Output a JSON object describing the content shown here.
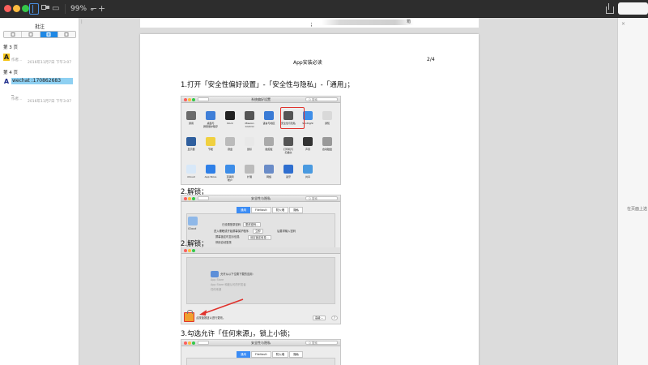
{
  "toolbar": {
    "zoom": "99% ⌄",
    "minus": "−",
    "plus": "+"
  },
  "sidebar": {
    "title": "批注",
    "sections": [
      {
        "page": "第 3 页",
        "author": "作者…",
        "date": "2016年11月7日 下午3:07"
      },
      {
        "page": "第 4 页",
        "highlight": "wechat :170862683",
        "dash": "_",
        "author": "作者…",
        "date": "2016年11月7日 下午3:07"
      }
    ]
  },
  "document": {
    "prev_page_semicolon": "；",
    "prev_page_blur_suffix": "箱",
    "page_title": "App安装必读",
    "page_number": "2/4",
    "steps": [
      "1.打开「安全性偏好设置」-「安全性与隐私」-「通用」；",
      "2.解锁；",
      "2.解锁；",
      "3.勾选允许「任何来源」，锁上小锁；"
    ],
    "shot1": {
      "title": "系统偏好设置",
      "search": "Q 搜索",
      "row1": [
        "通用",
        "桌面与\n屏幕保护程序",
        "Dock",
        "Mission\nControl",
        "语言与地区",
        "安全性与隐私",
        "Spotlight",
        "通知"
      ],
      "row2": [
        "显示器",
        "节能",
        "键盘",
        "鼠标",
        "触控板",
        "打印机与\n扫描仪",
        "声音",
        "启动磁盘"
      ],
      "row3": [
        "iCloud",
        "App Store",
        "互联网\n帐户",
        "扩展",
        "网络",
        "蓝牙",
        "共享"
      ]
    },
    "shot2": {
      "title": "安全性与隐私",
      "search": "Q 搜索",
      "tabs": [
        "通用",
        "FileVault",
        "防火墙",
        "隐私"
      ],
      "icloud_label": "iCloud",
      "login_pw": "已设置登录密码",
      "change_pw": "更改密码…",
      "require_pw": "进入睡眠或开始屏幕保护程序",
      "require_value": "立即",
      "require_suffix": "后要求输入密码",
      "show_msg": "屏幕锁定时显示信息",
      "set_msg": "设定锁定信息…",
      "auto_login": "停用自动登录"
    },
    "shot2b": {
      "allow_from": "允许从以下位置下载的应用：",
      "opt1": "App Store",
      "opt2": "App Store 和被认可的开发者",
      "opt3": "任何来源",
      "lock_text": "点按锁按钮以进行更改。",
      "advanced": "高级…",
      "help": "?"
    },
    "shot3": {
      "title": "安全性与隐私",
      "search": "Q 搜索",
      "tabs": [
        "通用",
        "FileVault",
        "防火墙",
        "隐私"
      ]
    }
  },
  "right_panel": {
    "close": "×",
    "text": "在页面上选"
  },
  "colors": {
    "accent_blue": "#1e88e5",
    "highlight": "#8ed0f2",
    "red_annotation": "#e0322c"
  }
}
